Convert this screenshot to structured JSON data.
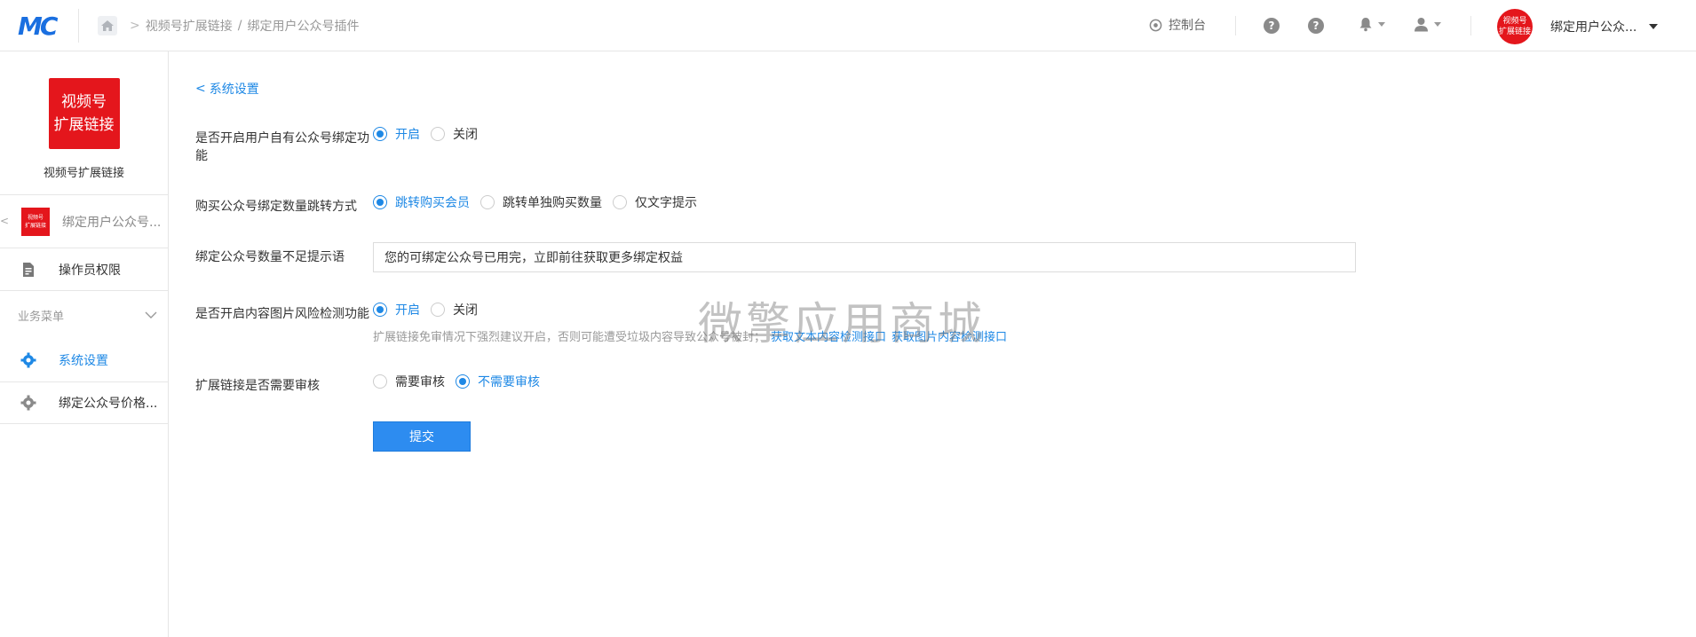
{
  "header": {
    "logo_text": "MC",
    "breadcrumb": [
      "视频号扩展链接",
      "绑定用户公众号插件"
    ],
    "breadcrumb_sep": "/",
    "console_label": "控制台",
    "account_name": "绑定用户公众...",
    "avatar_line1": "视频号",
    "avatar_line2": "扩展链接"
  },
  "sidebar": {
    "app_logo_line1": "视频号",
    "app_logo_line2": "扩展链接",
    "app_name": "视频号扩展链接",
    "plugin_thumb_line1": "视频号",
    "plugin_thumb_line2": "扩展链接",
    "plugin_name": "绑定用户公众号...",
    "operator_label": "操作员权限",
    "group_label": "业务菜单",
    "items": [
      {
        "label": "系统设置",
        "active": true
      },
      {
        "label": "绑定公众号价格..."
      }
    ]
  },
  "main": {
    "back_label": "系统设置",
    "fields": {
      "bind_feature": {
        "label_line1": "是否开启用户自有公众号绑定功",
        "label_line2": "能",
        "options": [
          "开启",
          "关闭"
        ],
        "selected": "开启"
      },
      "jump_mode": {
        "label": "购买公众号绑定数量跳转方式",
        "options": [
          "跳转购买会员",
          "跳转单独购买数量",
          "仅文字提示"
        ],
        "selected": "跳转购买会员"
      },
      "shortage_tip": {
        "label": "绑定公众号数量不足提示语",
        "value": "您的可绑定公众号已用完，立即前往获取更多绑定权益"
      },
      "risk_check": {
        "label": "是否开启内容图片风险检测功能",
        "options": [
          "开启",
          "关闭"
        ],
        "selected": "开启",
        "help": "扩展链接免审情况下强烈建议开启，否则可能遭受垃圾内容导致公众号被封；",
        "link1": "获取文本内容检测接口",
        "link2": "获取图片内容检测接口"
      },
      "review": {
        "label": "扩展链接是否需要审核",
        "options": [
          "需要审核",
          "不需要审核"
        ],
        "selected": "不需要审核"
      }
    },
    "submit_label": "提交"
  },
  "watermark": "微擎应用商城",
  "colors": {
    "accent": "#1e88e5",
    "brand_red": "#e4161c",
    "logo_blue": "#1a6fe0"
  }
}
